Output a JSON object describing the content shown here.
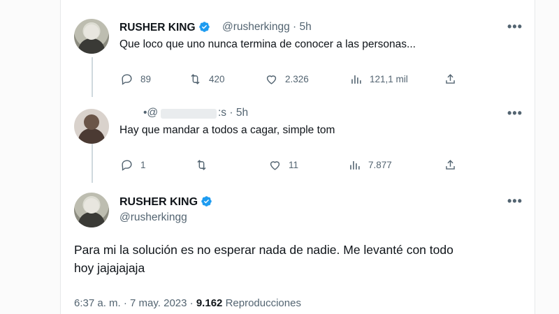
{
  "tweets": [
    {
      "name": "RUSHER KING",
      "handle": "@rusherkingg",
      "time": "5h",
      "text": "Que loco que uno nunca termina de conocer a las personas...",
      "replies": "89",
      "retweets": "420",
      "likes": "2.326",
      "views": "121,1 mil"
    },
    {
      "handle_partial_a": "•@",
      "handle_partial_b": ":s",
      "time": "5h",
      "text": "Hay que mandar a todos a cagar, simple tom",
      "replies": "1",
      "retweets": "",
      "likes": "11",
      "views": "7.877"
    }
  ],
  "main_tweet": {
    "name": "RUSHER KING",
    "handle": "@rusherkingg",
    "text": "Para mi la solución es no esperar nada de nadie. Me levanté con todo hoy jajajajaja",
    "time": "6:37 a. m.",
    "date": "7 may. 2023",
    "views": "9.162",
    "views_label": "Reproducciones"
  },
  "separator": "·",
  "more_glyph": "•••",
  "colors": {
    "verified": "#1d9bf0",
    "muted": "#536471",
    "text": "#0f1419"
  },
  "icons": [
    "reply-icon",
    "retweet-icon",
    "like-icon",
    "views-icon",
    "share-icon",
    "verified-badge-icon",
    "more-icon"
  ]
}
